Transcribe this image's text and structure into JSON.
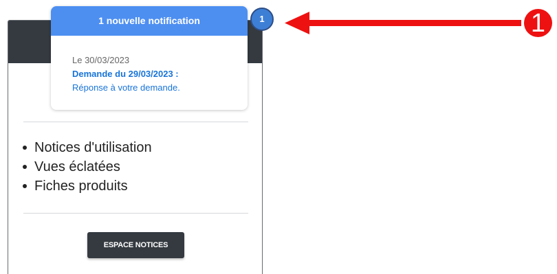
{
  "card": {
    "features": [
      "Notices d'utilisation",
      "Vues éclatées",
      "Fiches produits"
    ],
    "button_label": "ESPACE NOTICES"
  },
  "notification": {
    "header": "1 nouvelle notification",
    "date": "Le 30/03/2023",
    "title": "Demande du 29/03/2023 :",
    "message": "Réponse à votre demande.",
    "badge_count": "1"
  },
  "annotation": {
    "callout_number": "1",
    "color": "#ee1111"
  },
  "colors": {
    "notification_header": "#4d8ff1",
    "link_blue": "#1874d8",
    "dark": "#343a40"
  }
}
